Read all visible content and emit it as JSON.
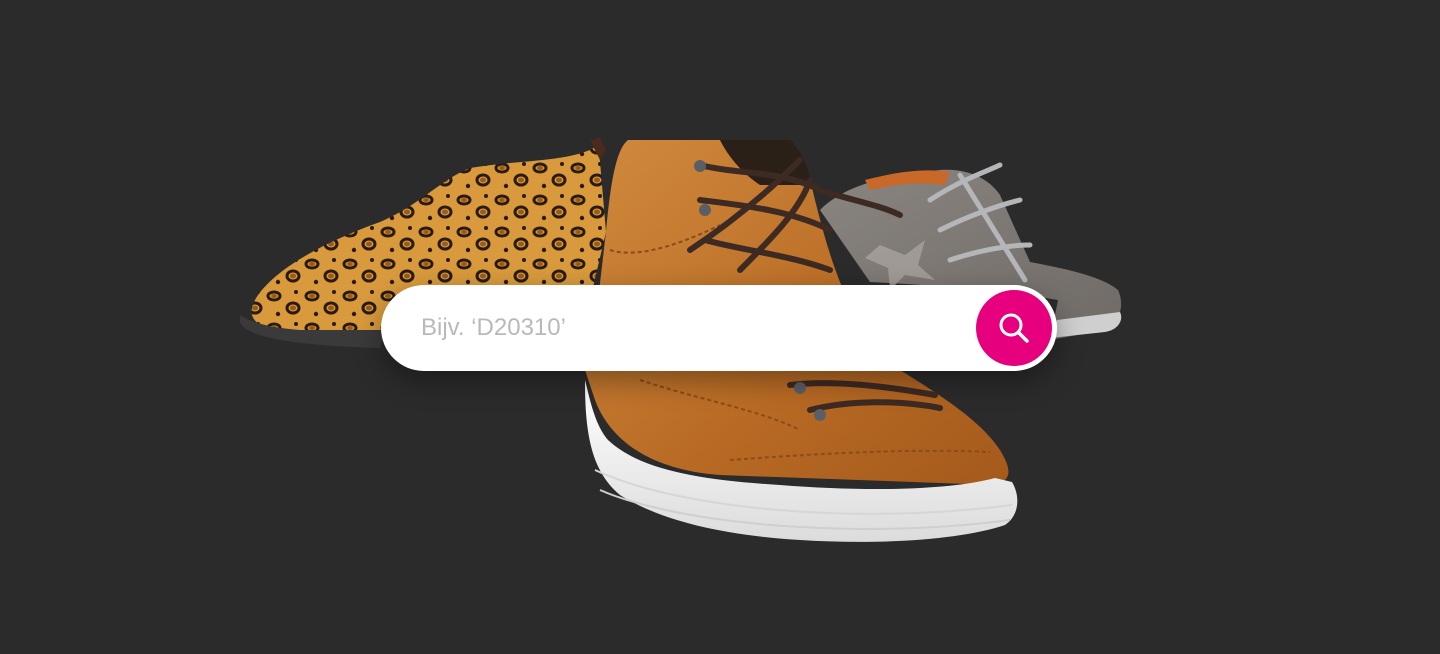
{
  "search": {
    "placeholder": "Bijv. ‘D20310’",
    "value": "",
    "button_icon": "search-icon"
  },
  "colors": {
    "background": "#2b2b2b",
    "accent": "#e6007e",
    "search_bar": "#ffffff",
    "placeholder_text": "#b9b9b9"
  },
  "hero_image": {
    "items": [
      "leopard-print-shoe",
      "cognac-high-top-sneaker",
      "grey-metallic-sneaker"
    ]
  }
}
